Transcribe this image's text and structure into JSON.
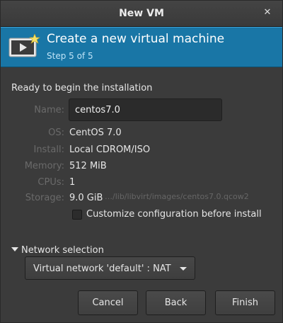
{
  "window": {
    "title": "New VM",
    "close_glyph": "✕"
  },
  "header": {
    "title": "Create a new virtual machine",
    "step": "Step 5 of 5",
    "icon": "virtual-machine-icon"
  },
  "summary": {
    "heading": "Ready to begin the installation",
    "name_label": "Name:",
    "name_value": "centos7.0",
    "os_label": "OS:",
    "os_value": "CentOS 7.0",
    "install_label": "Install:",
    "install_value": "Local CDROM/ISO",
    "memory_label": "Memory:",
    "memory_value": "512 MiB",
    "cpus_label": "CPUs:",
    "cpus_value": "1",
    "storage_label": "Storage:",
    "storage_value": "9.0 GiB",
    "storage_path": "…/lib/libvirt/images/centos7.0.qcow2"
  },
  "customize": {
    "label": "Customize configuration before install",
    "checked": false
  },
  "network": {
    "expander_label": "Network selection",
    "selected": "Virtual network 'default' : NAT"
  },
  "buttons": {
    "cancel": "Cancel",
    "back": "Back",
    "finish": "Finish"
  },
  "colors": {
    "header_bg": "#1976a6",
    "window_bg": "#3b3b3b"
  }
}
